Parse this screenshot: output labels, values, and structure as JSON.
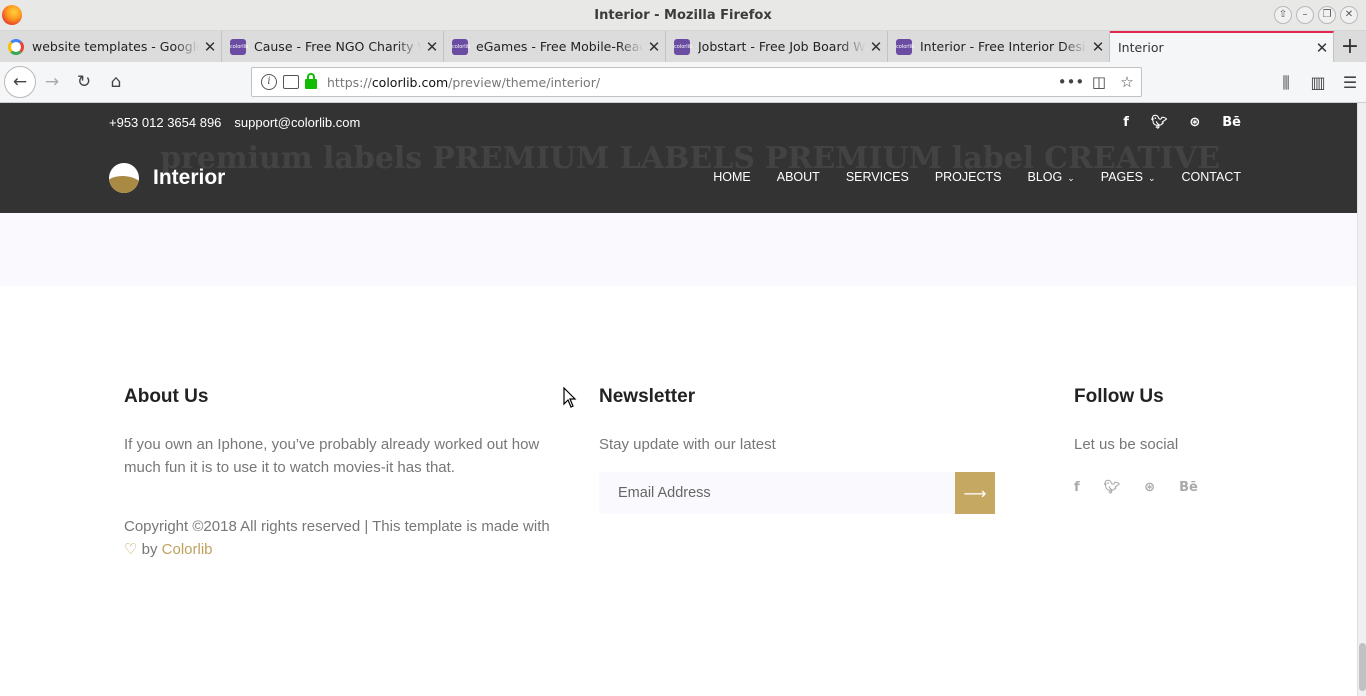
{
  "window": {
    "title": "Interior - Mozilla Firefox"
  },
  "tabs": [
    {
      "label": "website templates - Google S",
      "favicon": "google"
    },
    {
      "label": "Cause - Free NGO Charity We",
      "favicon": "colorlib"
    },
    {
      "label": "eGames - Free Mobile-Ready",
      "favicon": "colorlib"
    },
    {
      "label": "Jobstart - Free Job Board Web",
      "favicon": "colorlib"
    },
    {
      "label": "Interior - Free Interior Design",
      "favicon": "colorlib"
    },
    {
      "label": "Interior",
      "favicon": "none",
      "active": true
    }
  ],
  "address": {
    "prefix": "https://",
    "domain": "colorlib.com",
    "path": "/preview/theme/interior/"
  },
  "site": {
    "phone": "+953 012 3654 896",
    "email": "support@colorlib.com",
    "brand": "Interior",
    "nav": [
      "HOME",
      "ABOUT",
      "SERVICES",
      "PROJECTS",
      "BLOG",
      "PAGES",
      "CONTACT"
    ],
    "top_social": [
      "f",
      "t",
      "dribbble",
      "Bē"
    ],
    "ghost_logos": [
      "premium labels",
      "PREMIUM LABELS",
      "PREMIUM",
      "label",
      "CREATIVE"
    ]
  },
  "footer": {
    "about": {
      "title": "About Us",
      "text": "If you own an Iphone, you’ve probably already worked out how much fun it is to use it to watch movies-it has that.",
      "copyright": "Copyright ©2018 All rights reserved | This template is made with",
      "by": "by",
      "author": "Colorlib"
    },
    "newsletter": {
      "title": "Newsletter",
      "text": "Stay update with our latest",
      "placeholder": "Email Address"
    },
    "follow": {
      "title": "Follow Us",
      "text": "Let us be social"
    }
  },
  "colors": {
    "header_bg": "#333333",
    "accent": "#c5a963",
    "lavender": "#f9f9fe",
    "active_tab_line": "#e22850"
  }
}
